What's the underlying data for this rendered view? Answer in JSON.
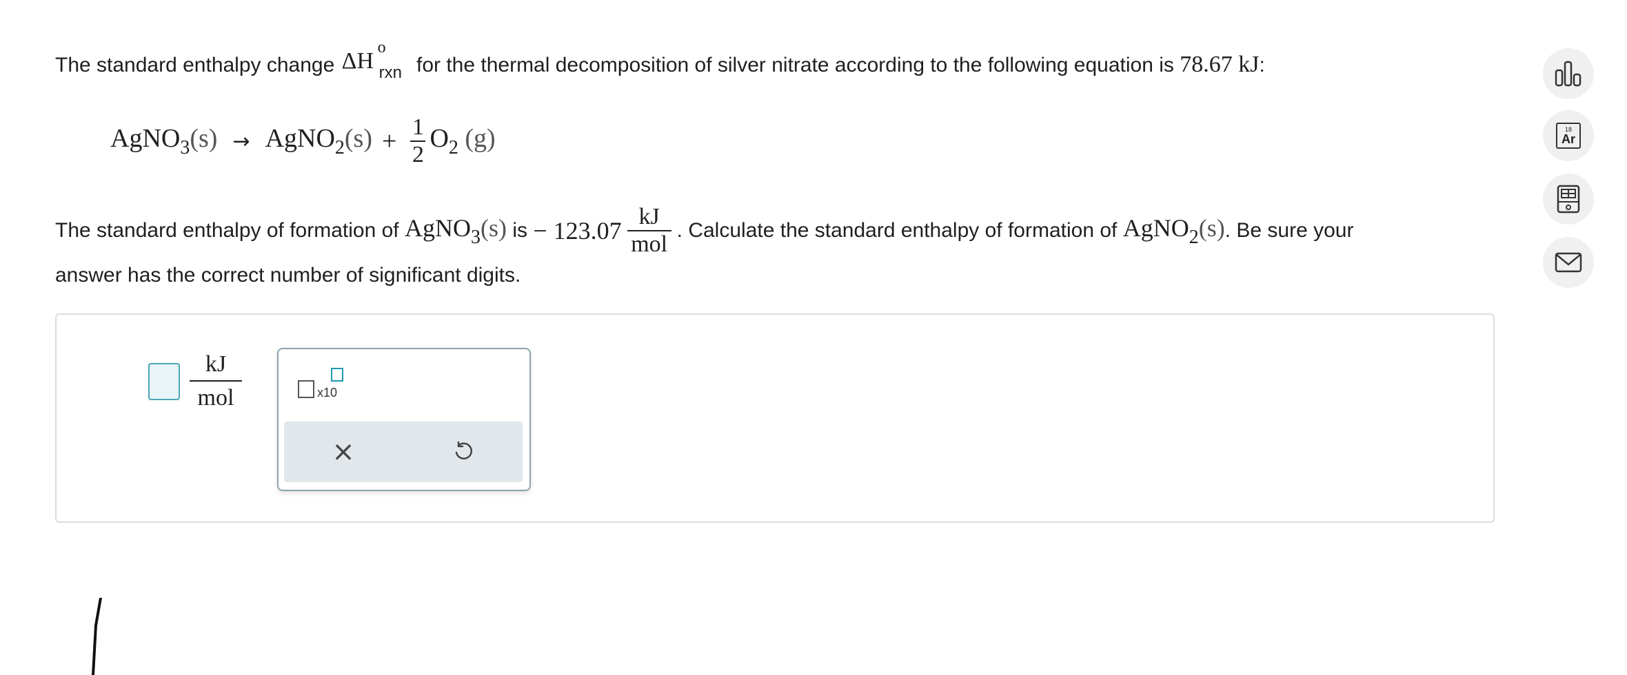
{
  "question": {
    "line1_a": "The standard enthalpy change",
    "delta_h": "ΔH",
    "delta_h_sup": "o",
    "delta_h_sub": "rxn",
    "line1_b": "for the thermal decomposition of silver nitrate according to the following equation is",
    "line1_value": "78.67 kJ",
    "line1_end": ":",
    "line2_a": "The standard enthalpy of formation of",
    "line2_is": "is",
    "line2_value": "− 123.07",
    "line2_b": ". Calculate the standard enthalpy of formation of",
    "line2_c": ". Be sure your",
    "line3": "answer has the correct number of significant digits."
  },
  "equation": {
    "reactant": "AgNO",
    "reactant_sub": "3",
    "reactant_state": "(s)",
    "arrow": "→",
    "product1": "AgNO",
    "product1_sub": "2",
    "product1_state": "(s)",
    "plus": "+",
    "coef_num": "1",
    "coef_den": "2",
    "product2": "O",
    "product2_sub": "2",
    "product2_state": "(g)"
  },
  "species": {
    "agno3": "AgNO",
    "agno3_sub": "3",
    "agno3_state": "(s)",
    "agno2": "AgNO",
    "agno2_sub": "2",
    "agno2_state": "(s)"
  },
  "units": {
    "num": "kJ",
    "den": "mol"
  },
  "answer": {
    "value": "",
    "unit_num": "kJ",
    "unit_den": "mol"
  },
  "toolbox": {
    "x10_label": "x10",
    "clear_symbol": "×"
  },
  "side_tools": {
    "periodic_number": "18",
    "periodic_symbol": "Ar"
  },
  "colors": {
    "accent": "#1a9bb0",
    "input_bg": "#e8f4f7",
    "toolbar_bg": "#e1e7ea"
  }
}
